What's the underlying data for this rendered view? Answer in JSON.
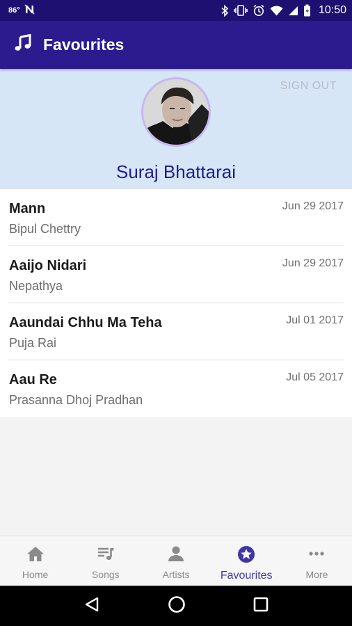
{
  "status_bar": {
    "temperature": "86°",
    "icons": [
      "notification-n-icon",
      "bluetooth-icon",
      "vibrate-icon",
      "alarm-icon",
      "wifi-icon",
      "signal-icon",
      "battery-icon"
    ],
    "time": "10:50"
  },
  "app_bar": {
    "icon": "music-note-icon",
    "title": "Favourites"
  },
  "profile": {
    "name": "Suraj Bhattarai",
    "sign_out": "SIGN OUT"
  },
  "songs": [
    {
      "title": "Mann",
      "artist": "Bipul Chettry",
      "date": "Jun 29 2017"
    },
    {
      "title": "Aaijo Nidari",
      "artist": "Nepathya",
      "date": "Jun 29 2017"
    },
    {
      "title": "Aaundai Chhu Ma Teha",
      "artist": "Puja Rai",
      "date": "Jul 01 2017"
    },
    {
      "title": "Aau Re",
      "artist": "Prasanna Dhoj Pradhan",
      "date": "Jul 05 2017"
    }
  ],
  "bottom_nav": [
    {
      "label": "Home",
      "icon": "home-icon"
    },
    {
      "label": "Songs",
      "icon": "playlist-icon"
    },
    {
      "label": "Artists",
      "icon": "person-icon"
    },
    {
      "label": "Favourites",
      "icon": "star-circle-icon",
      "active": true
    },
    {
      "label": "More",
      "icon": "more-dots-icon"
    }
  ],
  "colors": {
    "primary": "#2c1a8f",
    "status_bar": "#1e1070",
    "accent": "#3f36a6",
    "profile_bg": "#d6e6f7"
  }
}
